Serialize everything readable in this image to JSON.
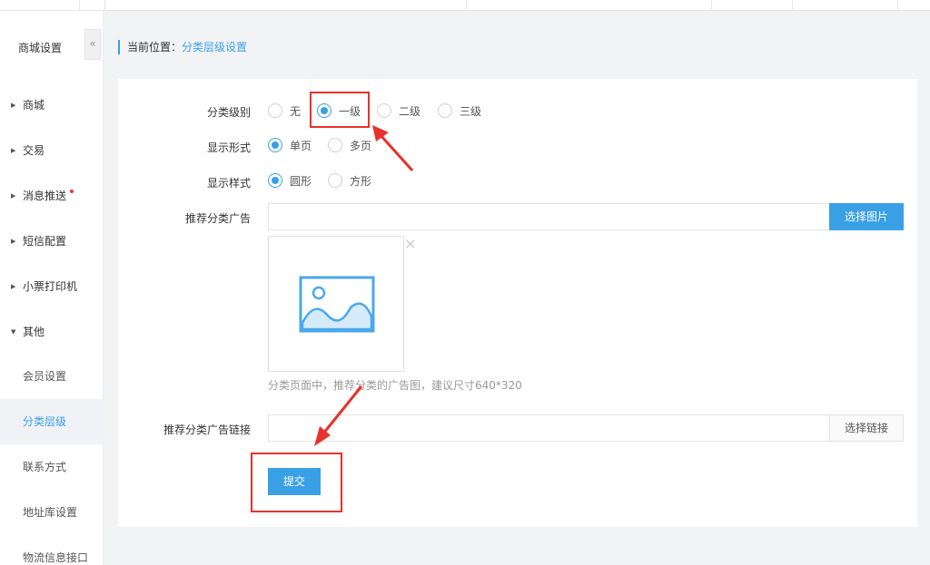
{
  "sidebar": {
    "title": "商城设置",
    "collapse_icon": "«",
    "items": [
      {
        "label": "商城"
      },
      {
        "label": "交易"
      },
      {
        "label": "消息推送"
      },
      {
        "label": "短信配置"
      },
      {
        "label": "小票打印机"
      },
      {
        "label": "其他"
      }
    ],
    "sub_items": [
      {
        "label": "会员设置"
      },
      {
        "label": "分类层级"
      },
      {
        "label": "联系方式"
      },
      {
        "label": "地址库设置"
      },
      {
        "label": "物流信息接口"
      }
    ]
  },
  "breadcrumb": {
    "prefix": "当前位置：",
    "current": "分类层级设置"
  },
  "form": {
    "level": {
      "label": "分类级别",
      "options": [
        "无",
        "一级",
        "二级",
        "三级"
      ],
      "selected": "一级"
    },
    "display_form": {
      "label": "显示形式",
      "options": [
        "单页",
        "多页"
      ],
      "selected": "单页"
    },
    "display_style": {
      "label": "显示样式",
      "options": [
        "圆形",
        "方形"
      ],
      "selected": "圆形"
    },
    "ad": {
      "label": "推荐分类广告",
      "value": "",
      "choose_button": "选择图片",
      "hint": "分类页面中，推荐分类的广告图，建议尺寸640*320",
      "remove_icon": "×"
    },
    "ad_link": {
      "label": "推荐分类广告链接",
      "value": "",
      "choose_button": "选择链接"
    },
    "submit": "提交"
  },
  "colors": {
    "accent": "#39a0e6",
    "annotation": "#e8312a",
    "unread_dot": "#e53935"
  }
}
